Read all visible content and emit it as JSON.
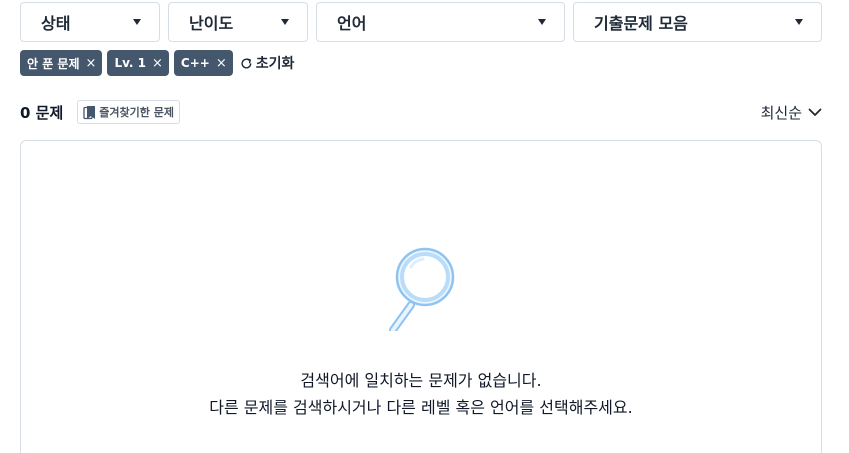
{
  "filters": [
    {
      "label": "상태"
    },
    {
      "label": "난이도"
    },
    {
      "label": "언어"
    },
    {
      "label": "기출문제 모음"
    }
  ],
  "active_filters": [
    {
      "label": "안 푼 문제"
    },
    {
      "label": "Lv. 1"
    },
    {
      "label": "C++"
    }
  ],
  "chip_remove_glyph": "×",
  "reset_label": "초기화",
  "summary": {
    "count_label": "0 문제",
    "bookmark_label": "즐겨찾기한 문제",
    "sort_label": "최신순"
  },
  "empty_state": {
    "line1": "검색어에 일치하는 문제가 없습니다.",
    "line2": "다른 문제를 검색하시거나 다른 레벨 혹은 언어를 선택해주세요."
  },
  "colors": {
    "chip_bg": "#44576c",
    "border": "#d7dde5",
    "magnifier": "#8fc4f0"
  }
}
